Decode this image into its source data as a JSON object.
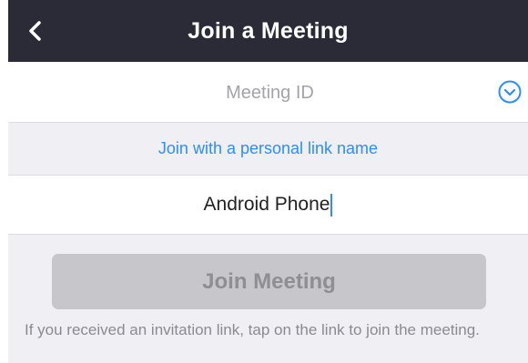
{
  "header": {
    "title": "Join a Meeting",
    "back_icon": "chevron-left-icon"
  },
  "meeting_id": {
    "placeholder": "Meeting ID",
    "value": "",
    "dropdown_icon": "chevron-down-circle-icon"
  },
  "personal_link": {
    "label": "Join with a personal link name"
  },
  "name_field": {
    "value": "Android Phone"
  },
  "join_button": {
    "label": "Join Meeting",
    "enabled": false
  },
  "hint": {
    "text": "If you received an invitation link, tap on the link to join the meeting."
  },
  "colors": {
    "header_bg": "#2b2b38",
    "accent": "#2d8cff",
    "disabled_button": "#c7c7cb",
    "background": "#f0f0f4"
  }
}
